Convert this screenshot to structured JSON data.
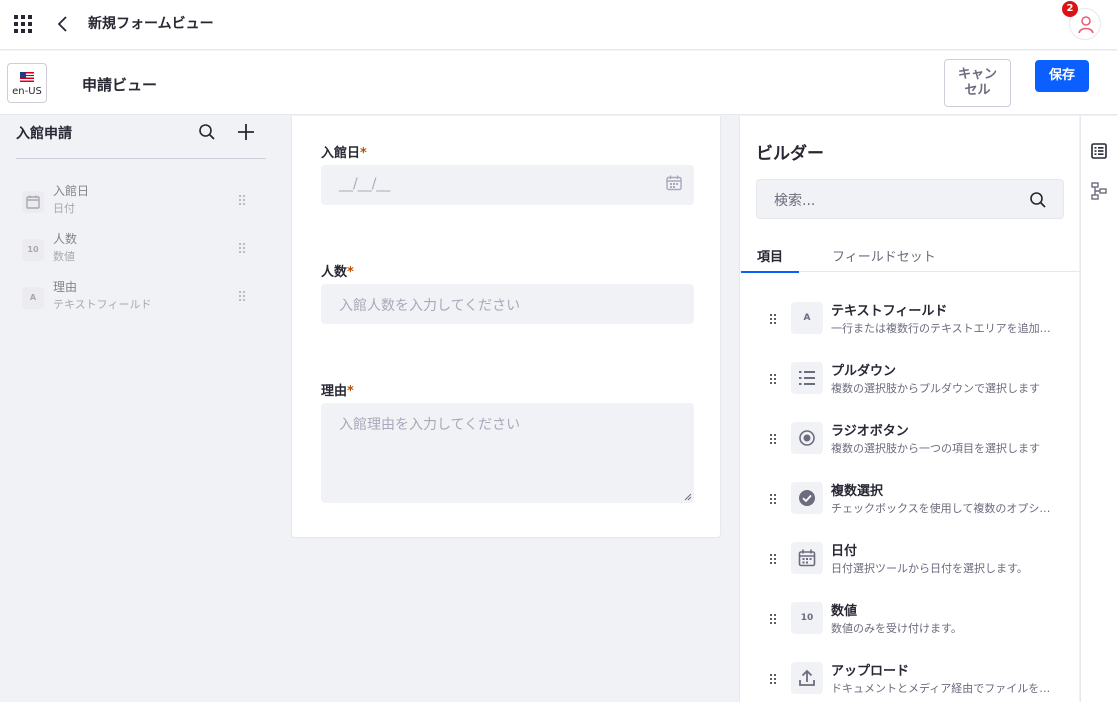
{
  "header": {
    "title": "新規フォームビュー",
    "notification_count": "2"
  },
  "subbar": {
    "locale": "en-US",
    "form_title": "申請ビュー",
    "cancel_label": "キャン\nセル",
    "save_label": "保存"
  },
  "sidebar": {
    "title": "入館申請",
    "fields": [
      {
        "name": "入館日",
        "type": "日付",
        "icon": "calendar-icon"
      },
      {
        "name": "人数",
        "type": "数値",
        "icon": "number-icon",
        "glyph": "10"
      },
      {
        "name": "理由",
        "type": "テキストフィールド",
        "icon": "text-icon",
        "glyph": "A"
      }
    ]
  },
  "form": {
    "fields": [
      {
        "label": "入館日",
        "required": "*",
        "placeholder": "__/__/__"
      },
      {
        "label": "人数",
        "required": "*",
        "placeholder": "入館人数を入力してください"
      },
      {
        "label": "理由",
        "required": "*",
        "placeholder": "入館理由を入力してください"
      }
    ]
  },
  "builder": {
    "title": "ビルダー",
    "search_placeholder": "検索...",
    "tabs": [
      {
        "label": "項目",
        "active": true
      },
      {
        "label": "フィールドセット",
        "active": false
      }
    ],
    "items": [
      {
        "name": "テキストフィールド",
        "desc": "一行または複数行のテキストエリアを追加します",
        "icon": "text-icon",
        "glyph": "A"
      },
      {
        "name": "プルダウン",
        "desc": "複数の選択肢からプルダウンで選択します",
        "icon": "list-icon"
      },
      {
        "name": "ラジオボタン",
        "desc": "複数の選択肢から一つの項目を選択します",
        "icon": "radio-icon"
      },
      {
        "name": "複数選択",
        "desc": "チェックボックスを使用して複数のオプションを選択します",
        "icon": "check-circle-icon"
      },
      {
        "name": "日付",
        "desc": "日付選択ツールから日付を選択します。",
        "icon": "calendar-icon"
      },
      {
        "name": "数値",
        "desc": "数値のみを受け付けます。",
        "icon": "number-icon",
        "glyph": "10"
      },
      {
        "name": "アップロード",
        "desc": "ドキュメントとメディア経由でファイルを送信します",
        "icon": "upload-icon"
      }
    ]
  },
  "colors": {
    "primary": "#0b5fff",
    "badge": "#da1414",
    "required": "#b95000"
  }
}
